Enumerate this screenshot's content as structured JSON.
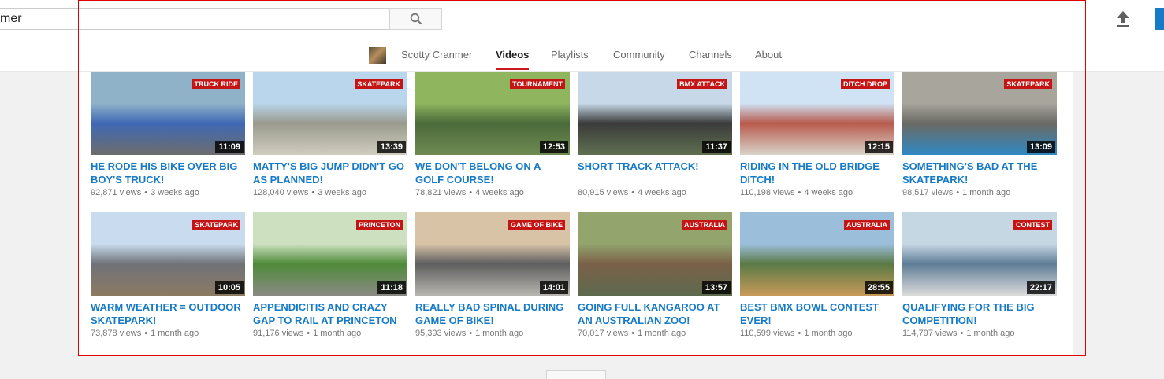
{
  "masthead": {
    "search_value": "mer",
    "search_icon": "search-icon",
    "upload_icon": "upload-icon"
  },
  "channel_nav": {
    "tabs": [
      {
        "label": "Scotty Cranmer",
        "active": false
      },
      {
        "label": "Videos",
        "active": true
      },
      {
        "label": "Playlists",
        "active": false
      },
      {
        "label": "Community",
        "active": false
      },
      {
        "label": "Channels",
        "active": false
      },
      {
        "label": "About",
        "active": false
      }
    ]
  },
  "videos": [
    {
      "title": "HE RODE HIS BIKE OVER BIG BOY'S TRUCK!",
      "duration": "11:09",
      "views": "92,871 views",
      "age": "3 weeks ago",
      "overlay": "TRUCK RIDE",
      "colors": [
        "#8fb2c8",
        "#3f69b5",
        "#6c6c6c"
      ]
    },
    {
      "title": "MATTY'S BIG JUMP DIDN'T GO AS PLANNED!",
      "duration": "13:39",
      "views": "128,040 views",
      "age": "3 weeks ago",
      "overlay": "SKATEPARK",
      "colors": [
        "#b9d6ec",
        "#9a9a8e",
        "#d0cdbf"
      ]
    },
    {
      "title": "WE DON'T BELONG ON A GOLF COURSE!",
      "duration": "12:53",
      "views": "78,821 views",
      "age": "4 weeks ago",
      "overlay": "TOURNAMENT",
      "colors": [
        "#8fb55f",
        "#4b6a3a",
        "#6f8a52"
      ]
    },
    {
      "title": "SHORT TRACK ATTACK!",
      "duration": "11:37",
      "views": "80,915 views",
      "age": "4 weeks ago",
      "overlay": "BMX ATTACK",
      "colors": [
        "#c7d9e8",
        "#3b3b3b",
        "#5f7050"
      ]
    },
    {
      "title": "RIDING IN THE OLD BRIDGE DITCH!",
      "duration": "12:15",
      "views": "110,198 views",
      "age": "4 weeks ago",
      "overlay": "DITCH DROP",
      "colors": [
        "#cfe3f4",
        "#b85b4e",
        "#d9d4c9"
      ]
    },
    {
      "title": "SOMETHING'S BAD AT THE SKATEPARK!",
      "duration": "13:09",
      "views": "98,517 views",
      "age": "1 month ago",
      "overlay": "SKATEPARK",
      "colors": [
        "#a7a59c",
        "#6b6a63",
        "#2f88c4"
      ]
    },
    {
      "title": "WARM WEATHER = OUTDOOR SKATEPARK!",
      "duration": "10:05",
      "views": "73,878 views",
      "age": "1 month ago",
      "overlay": "SKATEPARK",
      "colors": [
        "#c9dcef",
        "#6f7278",
        "#8c7a62"
      ]
    },
    {
      "title": "APPENDICITIS AND CRAZY GAP TO RAIL AT PRINCETON ...",
      "duration": "11:18",
      "views": "91,176 views",
      "age": "1 month ago",
      "overlay": "PRINCETON",
      "colors": [
        "#cde0c0",
        "#4f8a3a",
        "#8a8a84"
      ]
    },
    {
      "title": "REALLY BAD SPINAL DURING GAME OF BIKE!",
      "duration": "14:01",
      "views": "95,393 views",
      "age": "1 month ago",
      "overlay": "GAME OF BIKE",
      "colors": [
        "#d8c3a7",
        "#5e5e5e",
        "#b8b6b0"
      ]
    },
    {
      "title": "GOING FULL KANGAROO AT AN AUSTRALIAN ZOO!",
      "duration": "13:57",
      "views": "70,017 views",
      "age": "1 month ago",
      "overlay": "AUSTRALIA",
      "colors": [
        "#93a46d",
        "#7a6048",
        "#5d6a4e"
      ]
    },
    {
      "title": "BEST BMX BOWL CONTEST EVER!",
      "duration": "28:55",
      "views": "110,599 views",
      "age": "1 month ago",
      "overlay": "AUSTRALIA",
      "colors": [
        "#9bbedb",
        "#5a7a45",
        "#c89a5a"
      ]
    },
    {
      "title": "QUALIFYING FOR THE BIG COMPETITION!",
      "duration": "22:17",
      "views": "114,797 views",
      "age": "1 month ago",
      "overlay": "CONTEST",
      "colors": [
        "#c6d7e4",
        "#5f7d96",
        "#dcdcdc"
      ]
    }
  ]
}
